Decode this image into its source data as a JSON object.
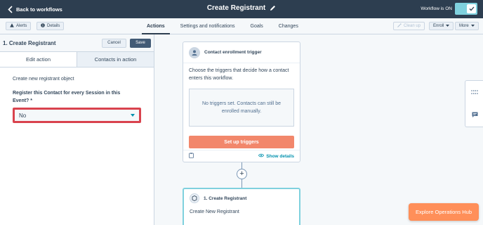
{
  "topbar": {
    "back_label": "Back to workflows",
    "title": "Create Registrant",
    "status_label": "Workflow is ON"
  },
  "subbar": {
    "alerts_label": "Alerts",
    "details_label": "Details",
    "tabs": [
      {
        "label": "Actions",
        "active": true
      },
      {
        "label": "Settings and notifications",
        "active": false
      },
      {
        "label": "Goals",
        "active": false
      },
      {
        "label": "Changes",
        "active": false
      }
    ],
    "cleanup_label": "Clean up",
    "enroll_label": "Enroll",
    "more_label": "More"
  },
  "panel": {
    "title": "1. Create Registrant",
    "cancel_label": "Cancel",
    "save_label": "Save",
    "tabs": [
      {
        "label": "Edit action",
        "active": true
      },
      {
        "label": "Contacts in action",
        "active": false
      }
    ],
    "object_text": "Create new registrant object",
    "field_label": "Register this Contact for every Session in this Event? *",
    "field_value": "No"
  },
  "canvas": {
    "trigger_title": "Contact enrollment trigger",
    "trigger_desc": "Choose the triggers that decide how a contact enters this workflow.",
    "empty_text": "No triggers set. Contacts can still be enrolled manually.",
    "setup_label": "Set up triggers",
    "show_details_label": "Show details",
    "plus_label": "+",
    "action_title": "1. Create Registrant",
    "action_desc": "Create New Registrant"
  },
  "explore_label": "Explore Operations Hub",
  "colors": {
    "topbar_bg": "#2d3e50",
    "toggle_on": "#7fd1de",
    "primary_button": "#425b76",
    "highlight_border": "#d9434e",
    "setup_button": "#f2876b",
    "link": "#0091ae",
    "explore_button": "#ff8f59"
  }
}
